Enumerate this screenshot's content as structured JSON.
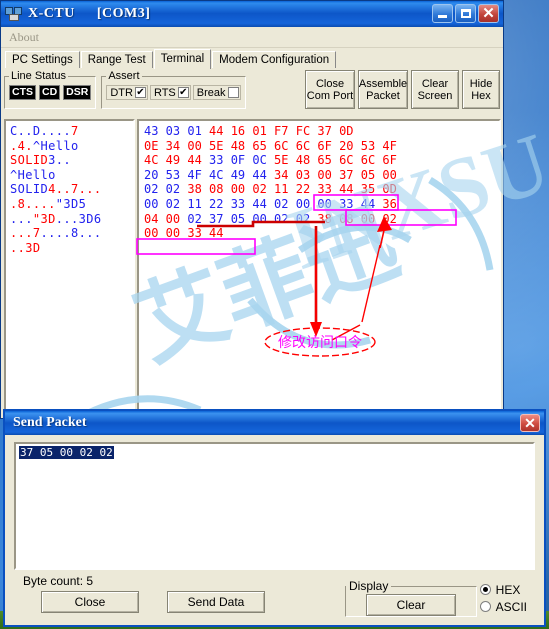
{
  "window": {
    "title": "X-CTU",
    "port": "[COM3]",
    "icon": "modem-icon",
    "buttons": {
      "minimize": "_",
      "maximize": "□",
      "close": "✕"
    }
  },
  "menu": {
    "items": [
      "About"
    ]
  },
  "tabs": [
    {
      "label": "PC Settings",
      "active": false
    },
    {
      "label": "Range Test",
      "active": false
    },
    {
      "label": "Terminal",
      "active": true
    },
    {
      "label": "Modem Configuration",
      "active": false
    }
  ],
  "toolbar": {
    "line_status": {
      "legend": "Line Status",
      "leds": [
        "CTS",
        "CD",
        "DSR"
      ]
    },
    "assert": {
      "legend": "Assert",
      "items": [
        {
          "label": "DTR",
          "checked": true,
          "mark": "✔"
        },
        {
          "label": "RTS",
          "checked": true,
          "mark": "✔"
        },
        {
          "label": "Break",
          "checked": false,
          "mark": ""
        }
      ]
    },
    "buttons": [
      {
        "line1": "Close",
        "line2": "Com Port"
      },
      {
        "line1": "Assemble",
        "line2": "Packet"
      },
      {
        "line1": "Clear",
        "line2": "Screen"
      },
      {
        "line1": "Hide",
        "line2": "Hex"
      }
    ]
  },
  "terminal": {
    "ascii_lines": [
      [
        {
          "t": "C..D....",
          "c": "blue"
        },
        {
          "t": "7",
          "c": "red"
        }
      ],
      [
        {
          "t": ".4.",
          "c": "red"
        },
        {
          "t": "^Hello",
          "c": "blue"
        }
      ],
      [
        {
          "t": "SOLID",
          "c": "red"
        },
        {
          "t": "3..",
          "c": "blue"
        }
      ],
      [
        {
          "t": "^Hello",
          "c": "blue"
        }
      ],
      [
        {
          "t": "SOLID",
          "c": "blue"
        },
        {
          "t": "4..7...",
          "c": "red"
        }
      ],
      [
        {
          "t": ".8....",
          "c": "red"
        },
        {
          "t": "\"3D5",
          "c": "blue"
        }
      ],
      [
        {
          "t": "...",
          "c": "blue"
        },
        {
          "t": "\"3D",
          "c": "red"
        },
        {
          "t": "...3D6",
          "c": "blue"
        }
      ],
      [
        {
          "t": "...7",
          "c": "red"
        },
        {
          "t": "....8...",
          "c": "blue"
        }
      ],
      [
        {
          "t": "..3D",
          "c": "red"
        }
      ]
    ],
    "hex_lines": [
      [
        {
          "t": "43 03 01",
          "c": "blue"
        },
        {
          "t": "44 16 01 F7 FC 37 0D",
          "c": "red"
        }
      ],
      [
        {
          "t": "0E 34 00 5E 48 65 6C 6C 6F 20 53 4F",
          "c": "red"
        }
      ],
      [
        {
          "t": "4C 49 44",
          "c": "red"
        },
        {
          "t": "33 0F 0C",
          "c": "blue"
        },
        {
          "t": "5E 48 65 6C 6C 6F",
          "c": "red"
        }
      ],
      [
        {
          "t": "20 53 4F 4C 49 44",
          "c": "blue"
        },
        {
          "t": "34 03 00 37 05 00",
          "c": "red"
        }
      ],
      [
        {
          "t": "02 02",
          "c": "blue"
        },
        {
          "t": "38 08 00 02 11 22 33 44 35 0D",
          "c": "red"
        }
      ],
      [
        {
          "t": "00 02 11 22 33 44 02 00 00 33 44",
          "c": "blue"
        },
        {
          "t": "36",
          "c": "red"
        }
      ],
      [
        {
          "t": "04 00",
          "c": "red"
        },
        {
          "t": "02 37",
          "c": "blue"
        },
        {
          "t": "05 00 02 02",
          "c": "blue"
        },
        {
          "t": "38 08 00 02",
          "c": "red"
        }
      ],
      [
        {
          "t": "00 00 33 44",
          "c": "red"
        }
      ]
    ],
    "annotation": {
      "note": "修改访问口令",
      "highlight_color": "#ff00ff",
      "arrow_color": "#ff0000"
    },
    "watermark": "迅 INXSU"
  },
  "send_packet": {
    "title": "Send Packet",
    "close_icon": "✕",
    "value": "37 05 00 02 02",
    "byte_count_label": "Byte count: 5",
    "close_button": "Close",
    "send_button": "Send Data",
    "display": {
      "legend": "Display",
      "clear_button": "Clear",
      "options": [
        {
          "label": "HEX",
          "selected": true
        },
        {
          "label": "ASCII",
          "selected": false
        }
      ]
    }
  }
}
